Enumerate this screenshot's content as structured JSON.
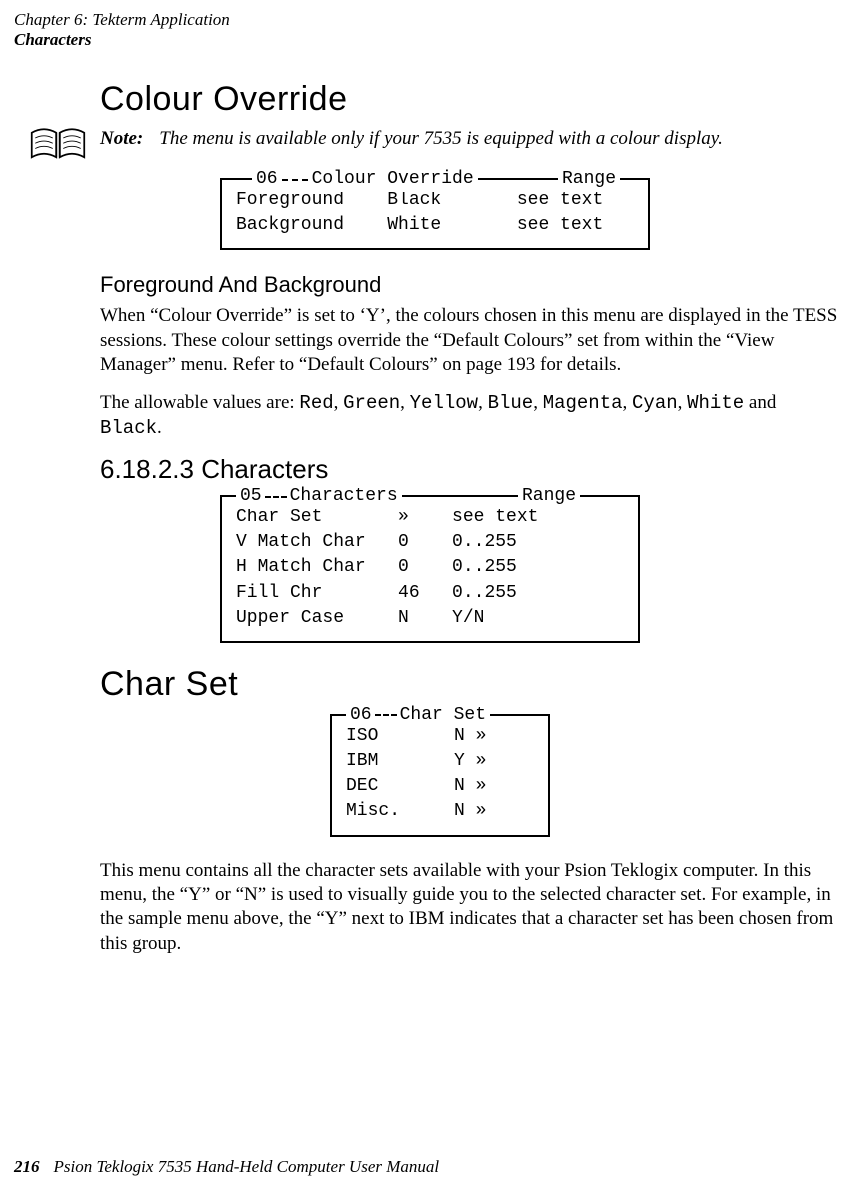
{
  "running_head": {
    "line1": "Chapter 6: Tekterm Application",
    "line2": "Characters"
  },
  "sec1": {
    "title": "Colour Override",
    "note_label": "Note:",
    "note_body": "The menu is available only if your 7535 is equipped with a colour display."
  },
  "menu1": {
    "legend_num": "06",
    "legend_title": "Colour Override",
    "legend_range": "Range",
    "rows": [
      "Foreground    Black       see text",
      "Background    White       see text"
    ]
  },
  "sub1": {
    "title": "Foreground And Background",
    "para1": "When “Colour Override” is set to ‘Y’, the colours chosen in this menu are displayed in the TESS sessions. These colour settings override the “Default Colours” set from within the “View Manager” menu. Refer to “Default Colours” on page 193 for details.",
    "para2_pre": "The allowable values are: ",
    "para2_vals": [
      "Red",
      "Green",
      "Yellow",
      "Blue",
      "Magenta",
      "Cyan",
      "White"
    ],
    "para2_and": " and ",
    "para2_last": "Black",
    "para2_post": "."
  },
  "sec2": {
    "number_title": "6.18.2.3  Characters"
  },
  "menu2": {
    "legend_num": "05",
    "legend_title": "Characters",
    "legend_range": "Range",
    "rows": [
      "Char Set       »    see text",
      "V Match Char   0    0..255",
      "H Match Char   0    0..255",
      "Fill Chr       46   0..255",
      "Upper Case     N    Y/N"
    ]
  },
  "sec3": {
    "title": "Char Set"
  },
  "menu3": {
    "legend_num": "06",
    "legend_title": "Char Set",
    "rows": [
      "ISO       N »",
      "IBM       Y »",
      "DEC       N »",
      "Misc.     N »"
    ]
  },
  "tail_para": "This menu contains all the character sets available with your Psion Teklogix computer. In this menu, the “Y” or “N” is used to visually guide you to the selected character set. For example, in the sample menu above, the “Y” next to IBM indicates that a character set has been chosen from this group.",
  "footer": {
    "page": "216",
    "book": "Psion Teklogix 7535 Hand-Held Computer User Manual"
  }
}
